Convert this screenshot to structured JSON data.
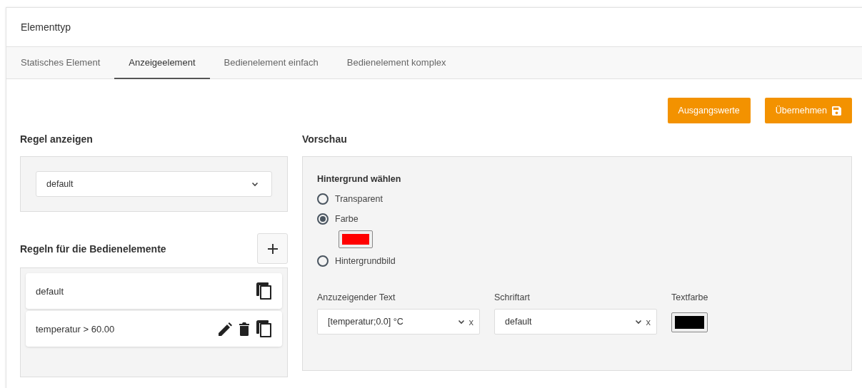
{
  "panel": {
    "title": "Elementtyp"
  },
  "tabs": [
    {
      "label": "Statisches Element",
      "selected": false
    },
    {
      "label": "Anzeigeelement",
      "selected": true
    },
    {
      "label": "Bedienelement einfach",
      "selected": false
    },
    {
      "label": "Bedienelement komplex",
      "selected": false
    }
  ],
  "actions": [
    {
      "label": "Ausgangswerte",
      "kind": "plain"
    },
    {
      "label": "Übernehmen",
      "kind": "save"
    }
  ],
  "display_rule": {
    "heading": "Regel anzeigen",
    "value": "default"
  },
  "rules": {
    "heading": "Regeln für die Bedienelemente",
    "items": [
      {
        "name": "default",
        "editable": false
      },
      {
        "name": "temperatur > 60.00",
        "editable": true
      }
    ]
  },
  "preview": {
    "heading": "Vorschau",
    "background": {
      "label": "Hintergrund wählen",
      "color": "#ff0000",
      "options": [
        {
          "label": "Transparent",
          "kind": "transparent",
          "selected": false
        },
        {
          "label": "Farbe",
          "kind": "color",
          "selected": true
        },
        {
          "label": "Hintergrundbild",
          "kind": "image",
          "selected": false
        }
      ]
    },
    "fields": [
      {
        "kind": "select",
        "label": "Anzuzeigender Text",
        "value": "[temperatur;0.0] °C",
        "clear": "x"
      },
      {
        "kind": "select",
        "label": "Schriftart",
        "value": "default",
        "clear": "x"
      },
      {
        "kind": "color",
        "label": "Textfarbe",
        "color": "#000000"
      }
    ]
  }
}
